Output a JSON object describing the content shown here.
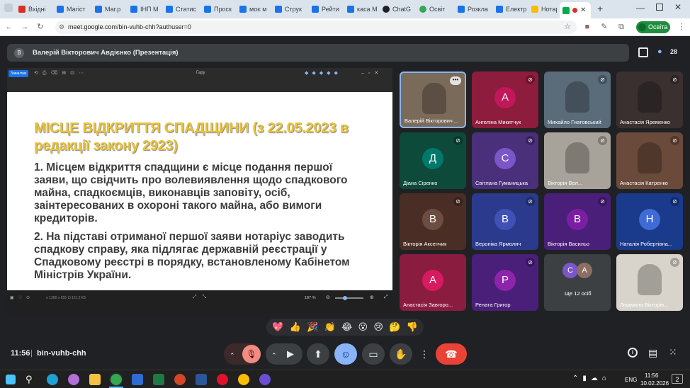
{
  "browser": {
    "tabs": [
      {
        "label": "Вхідні",
        "color": "#d93025"
      },
      {
        "label": "Магіст",
        "color": "#1a73e8"
      },
      {
        "label": "Маг.р",
        "color": "#1a73e8"
      },
      {
        "label": "ІНП М",
        "color": "#1a73e8"
      },
      {
        "label": "Статис",
        "color": "#1a73e8"
      },
      {
        "label": "Проск",
        "color": "#1a73e8"
      },
      {
        "label": "моє м",
        "color": "#1a73e8"
      },
      {
        "label": "Струк",
        "color": "#1a73e8"
      },
      {
        "label": "Рейти",
        "color": "#1a73e8"
      },
      {
        "label": "каса М",
        "color": "#1a73e8"
      },
      {
        "label": "ChatG",
        "color": "#202124"
      },
      {
        "label": "Освіт",
        "color": "#34a853"
      },
      {
        "label": "Розкла",
        "color": "#1a73e8"
      },
      {
        "label": "Електр",
        "color": "#1a73e8"
      },
      {
        "label": "Нотар",
        "color": "#fbbc04"
      }
    ],
    "url": "meet.google.com/bin-vuhb-chh?authuser=0",
    "profile_label": "Освіта"
  },
  "meeting": {
    "presenter_avatar": "В",
    "presentation_title": "Валерій Вікторович Авдієнко (Презентація)",
    "participant_count": "28",
    "time": "11:56",
    "code": "bin-vuhb-chh"
  },
  "slide": {
    "title_line1": "МІСЦЕ ВІДКРИТТЯ СПАДЩИНИ  (з 22.05.2023 в",
    "title_line2": "редакції закону 2923)",
    "p1": [
      "1. Місцем відкриття спадщини є місце подання першої",
      "заяви, що свідчить про волевиявлення щодо спадкового",
      "майна, спадкоємців, виконавців заповіту, осіб,",
      "заінтересованих в охороні такого майна, або вимоги",
      "кредиторів."
    ],
    "p2": [
      "2. На підставі отриманої першої заяви нотаріус заводить",
      "спадкову справу, яка підлягає державній реєстрації у",
      "Спадковому реєстрі в порядку, встановленому Кабінетом",
      "Міністрів України."
    ],
    "toolbar_label": "Завантаж",
    "doc_name": "Гару",
    "zoom": "187 %",
    "status_text": "≡  1280 x 655   ⊡  121,2 КБ"
  },
  "participants": [
    {
      "name": "Валерій Вікторович ...",
      "initial": "",
      "bg": "#7a6a5a",
      "video": true,
      "muted": false
    },
    {
      "name": "Ангеліна Микитчук",
      "initial": "А",
      "bg": "#8e1c3c",
      "circ": "#c2185b",
      "video": false,
      "muted": true
    },
    {
      "name": "Михайло Гнатовський",
      "initial": "",
      "bg": "#5a6b7a",
      "video": true,
      "muted": true
    },
    {
      "name": "Анастасія Яременко",
      "initial": "",
      "bg": "#3a3030",
      "video": true,
      "muted": true
    },
    {
      "name": "Діана Сіренко",
      "initial": "Д",
      "bg": "#0d4a3a",
      "circ": "#00796b",
      "video": false,
      "muted": true
    },
    {
      "name": "Світлана Гуманицька",
      "initial": "С",
      "bg": "#4a2f7a",
      "circ": "#7b56c8",
      "video": false,
      "muted": true
    },
    {
      "name": "Вікторія Вол...",
      "initial": "",
      "bg": "#a8a39a",
      "video": true,
      "muted": true
    },
    {
      "name": "Анастасія Катренко",
      "initial": "",
      "bg": "#6a4a3a",
      "video": true,
      "muted": true
    },
    {
      "name": "Вікторія Аксенчик",
      "initial": "В",
      "bg": "#4a2e26",
      "circ": "#6d4c41",
      "video": false,
      "muted": true
    },
    {
      "name": "Вероніка Ярмолич",
      "initial": "В",
      "bg": "#2b3a8c",
      "circ": "#3f51b5",
      "video": false,
      "muted": true
    },
    {
      "name": "Вікторія Васильо",
      "initial": "В",
      "bg": "#4a1f7a",
      "circ": "#7b1fa2",
      "video": false,
      "muted": true
    },
    {
      "name": "Наталія Робертівна...",
      "initial": "Н",
      "bg": "#1a3a8c",
      "circ": "#3f6bd6",
      "video": false,
      "muted": true
    },
    {
      "name": "Анастасія Завгоро...",
      "initial": "А",
      "bg": "#8a1c40",
      "circ": "#d81b60",
      "video": false,
      "muted": false
    },
    {
      "name": "Рената Григор",
      "initial": "Р",
      "bg": "#4a1f7a",
      "circ": "#8e24aa",
      "video": false,
      "muted": true
    },
    {
      "name": "Ще 12 осіб",
      "initial": "",
      "bg": "#3c4043",
      "video": false,
      "muted": false
    },
    {
      "name": "Людмила Вікторів...",
      "initial": "",
      "bg": "#d8d4cc",
      "video": true,
      "muted": true
    }
  ],
  "more_tile": {
    "circle1": "С",
    "circle2": "А"
  },
  "reactions": [
    "💖",
    "👍",
    "🎉",
    "👏",
    "😂",
    "😮",
    "😢",
    "🤔",
    "👎"
  ],
  "taskbar": {
    "lang": "ENG",
    "time": "11:56",
    "date": "10.02.2026",
    "badge": "2"
  }
}
